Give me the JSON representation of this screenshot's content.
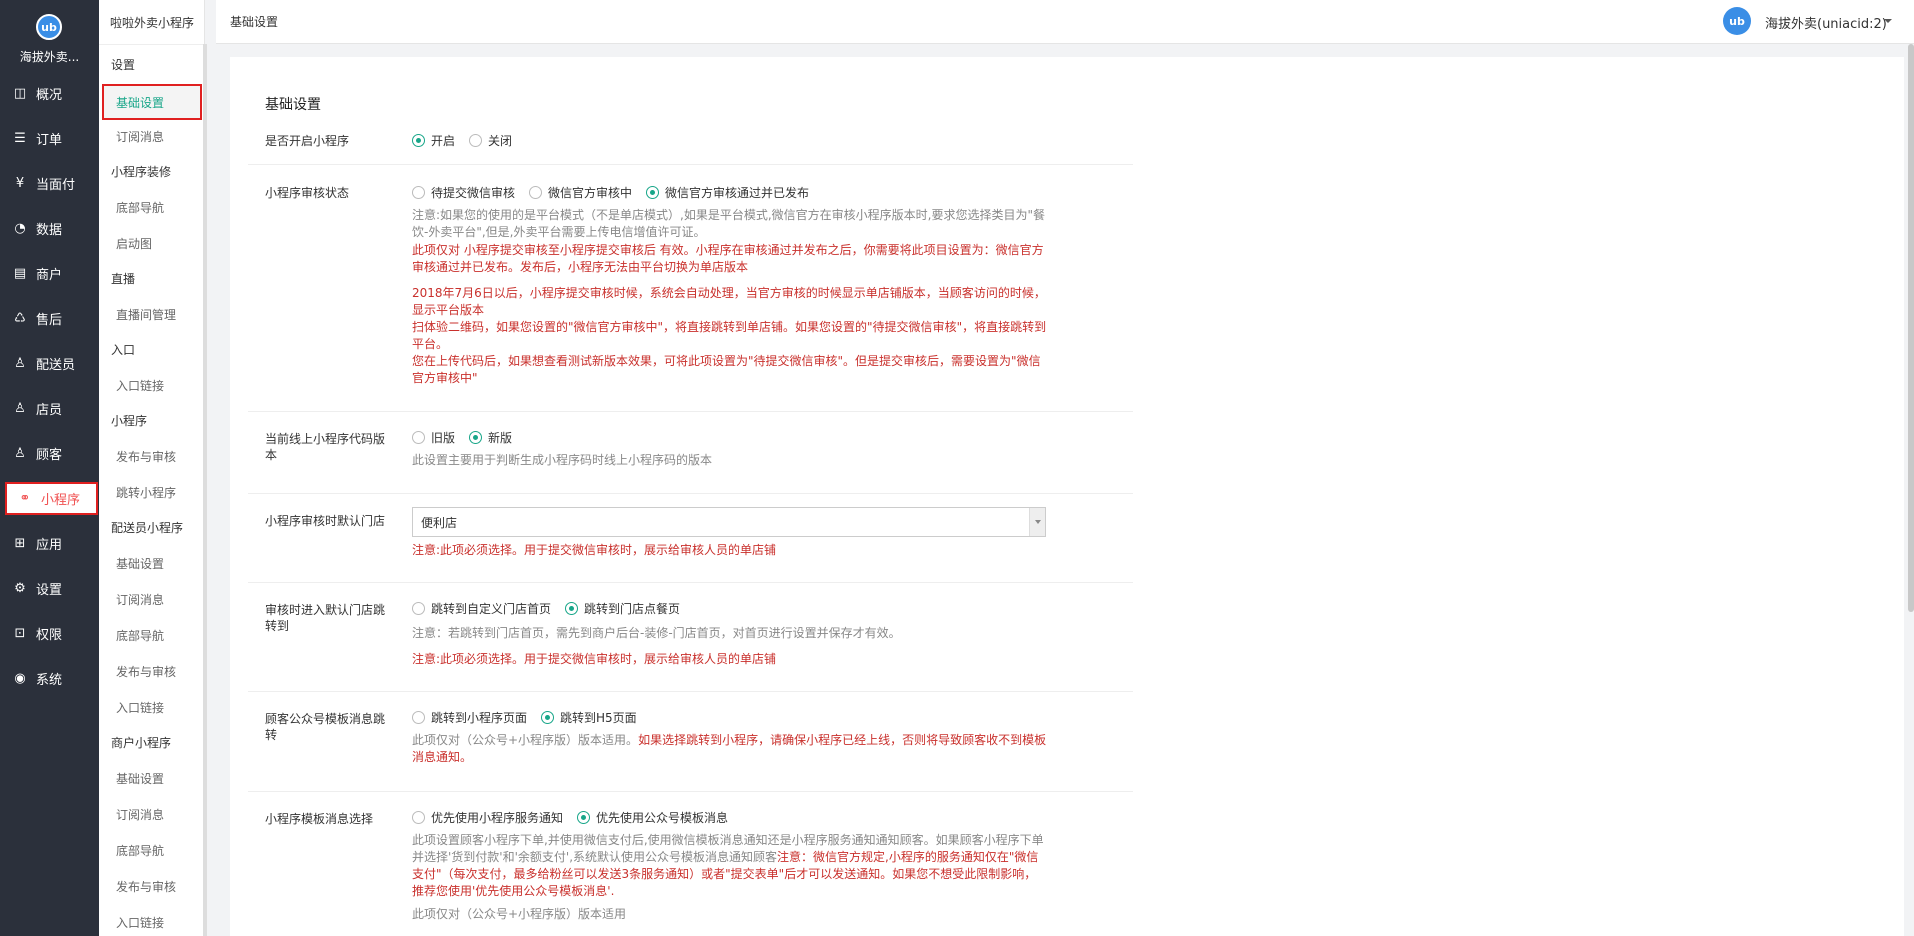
{
  "brand": {
    "logo_text": "ub",
    "title": "海拔外卖..."
  },
  "leftnav": {
    "items": [
      {
        "label": "概况",
        "icon": "overview-icon"
      },
      {
        "label": "订单",
        "icon": "order-icon"
      },
      {
        "label": "当面付",
        "icon": "yuan-icon"
      },
      {
        "label": "数据",
        "icon": "chart-icon"
      },
      {
        "label": "商户",
        "icon": "store-icon"
      },
      {
        "label": "售后",
        "icon": "aftersale-icon"
      },
      {
        "label": "配送员",
        "icon": "rider-icon"
      },
      {
        "label": "店员",
        "icon": "clerk-icon"
      },
      {
        "label": "顾客",
        "icon": "customer-icon"
      },
      {
        "label": "小程序",
        "icon": "miniapp-icon"
      },
      {
        "label": "应用",
        "icon": "apps-icon"
      },
      {
        "label": "设置",
        "icon": "gear-icon"
      },
      {
        "label": "权限",
        "icon": "lock-icon"
      },
      {
        "label": "系统",
        "icon": "system-icon"
      }
    ]
  },
  "subnav": {
    "header": "啦啦外卖小程序",
    "groups": [
      "设置",
      "直播",
      "入口",
      "小程序",
      "配送员小程序",
      "商户小程序"
    ],
    "active": "基础设置",
    "items": [
      "订阅消息",
      "小程序装修",
      "底部导航",
      "启动图",
      "直播间管理",
      "入口链接",
      "发布与审核",
      "跳转小程序",
      "基础设置",
      "订阅消息",
      "底部导航",
      "发布与审核",
      "入口链接",
      "基础设置",
      "订阅消息",
      "底部导航",
      "发布与审核",
      "入口链接"
    ]
  },
  "topbar": {
    "title": "基础设置",
    "user_avatar": "ub",
    "user_name": "海拔外卖(uniacid:2)"
  },
  "form": {
    "section_title": "基础设置",
    "enable": {
      "label": "是否开启小程序",
      "options": [
        "开启",
        "关闭"
      ],
      "selected": "开启"
    },
    "audit_status": {
      "label": "小程序审核状态",
      "options": [
        "待提交微信审核",
        "微信官方审核中",
        "微信官方审核通过并已发布"
      ],
      "selected": "微信官方审核通过并已发布",
      "note_gray": "注意:如果您的使用的是平台模式（不是单店模式）,如果是平台模式,微信官方在审核小程序版本时,要求您选择类目为\"餐饮-外卖平台\",但是,外卖平台需要上传电信增值许可证。",
      "note_red1": "此项仅对 小程序提交审核至小程序提交审核后 有效。小程序在审核通过并发布之后，你需要将此项目设置为：微信官方审核通过并已发布。发布后，小程序无法由平台切换为单店版本",
      "note_red2": "2018年7月6日以后，小程序提交审核时候，系统会自动处理，当官方审核的时候显示单店铺版本，当顾客访问的时候，显示平台版本",
      "note_red3": "扫体验二维码，如果您设置的\"微信官方审核中\"，将直接跳转到单店铺。如果您设置的\"待提交微信审核\"，将直接跳转到平台。",
      "note_red4": "您在上传代码后，如果想查看测试新版本效果，可将此项设置为\"待提交微信审核\"。但是提交审核后，需要设置为\"微信官方审核中\""
    },
    "code_version": {
      "label": "当前线上小程序代码版本",
      "options": [
        "旧版",
        "新版"
      ],
      "selected": "新版",
      "note": "此设置主要用于判断生成小程序码时线上小程序码的版本"
    },
    "default_store": {
      "label": "小程序审核时默认门店",
      "value": "便利店",
      "note": "注意:此项必须选择。用于提交微信审核时，展示给审核人员的单店铺"
    },
    "audit_jump": {
      "label": "审核时进入默认门店跳转到",
      "options": [
        "跳转到自定义门店首页",
        "跳转到门店点餐页"
      ],
      "selected": "跳转到门店点餐页",
      "note_gray": "注意：若跳转到门店首页，需先到商户后台-装修-门店首页，对首页进行设置并保存才有效。",
      "note_red": "注意:此项必须选择。用于提交微信审核时，展示给审核人员的单店铺"
    },
    "template_jump": {
      "label": "顾客公众号模板消息跳转",
      "options": [
        "跳转到小程序页面",
        "跳转到H5页面"
      ],
      "selected": "跳转到H5页面",
      "note_gray": "此项仅对（公众号+小程序版）版本适用。",
      "note_red": "如果选择跳转到小程序，请确保小程序已经上线，否则将导致顾客收不到模板消息通知。"
    },
    "template_choice": {
      "label": "小程序模板消息选择",
      "options": [
        "优先使用小程序服务通知",
        "优先使用公众号模板消息"
      ],
      "selected": "优先使用公众号模板消息",
      "note_gray": "此项设置顾客小程序下单,并使用微信支付后,使用微信模板消息通知还是小程序服务通知通知顾客。如果顾客小程序下单并选择'货到付款'和'余额支付',系统默认使用公众号模板消息通知顾客",
      "note_red": "注意：微信官方规定,小程序的服务通知仅在\"微信支付\"（每次支付，最多给粉丝可以发送3条服务通知）或者\"提交表单\"后才可以发送通知。如果您不想受此限制影响，推荐您使用'优先使用公众号模板消息'.",
      "note_tail": "此项仅对（公众号+小程序版）版本适用"
    }
  }
}
